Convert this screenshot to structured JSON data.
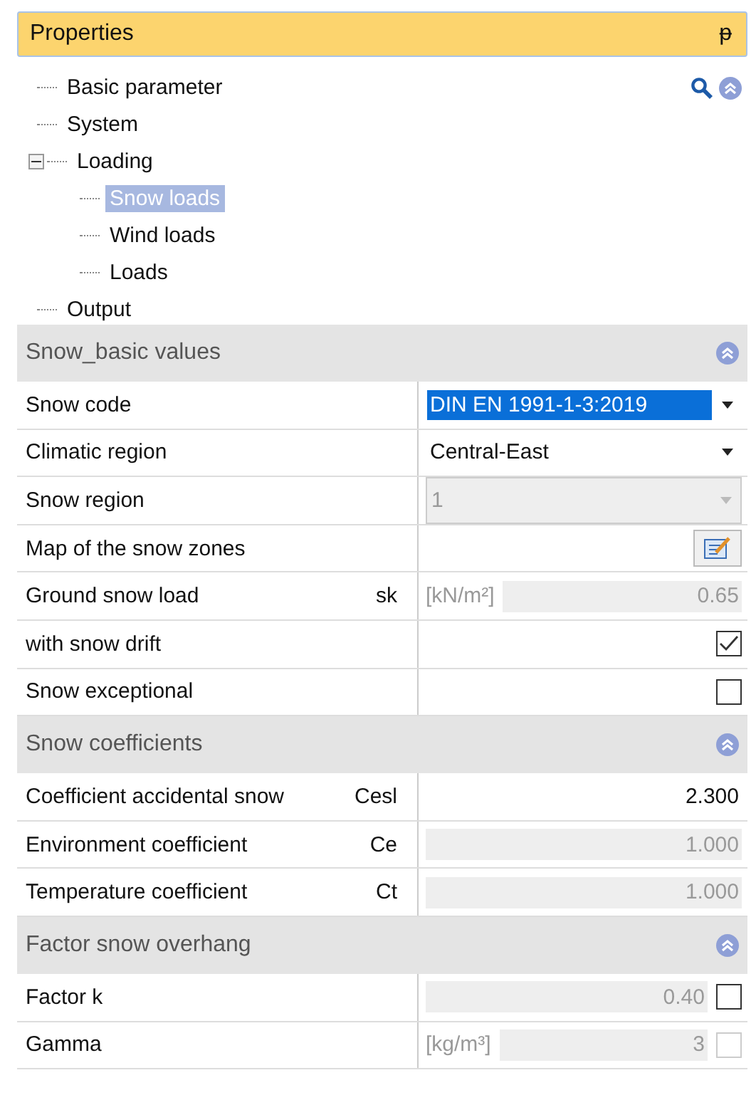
{
  "panel": {
    "title": "Properties",
    "pin": "ᵽ"
  },
  "tree": [
    {
      "label": "Basic parameter",
      "selected": false
    },
    {
      "label": "System",
      "selected": false
    },
    {
      "label": "Loading",
      "selected": false,
      "expanded": true,
      "children": [
        {
          "label": "Snow loads",
          "selected": true
        },
        {
          "label": "Wind loads",
          "selected": false
        },
        {
          "label": "Loads",
          "selected": false
        }
      ]
    },
    {
      "label": "Output",
      "selected": false
    }
  ],
  "sections": [
    {
      "title": "Snow_basic values",
      "expanded": true,
      "rows": [
        {
          "kind": "dropdown",
          "label": "Snow code",
          "value": "DIN EN 1991-1-3:2019",
          "highlighted": true,
          "disabled": false
        },
        {
          "kind": "dropdown",
          "label": "Climatic region",
          "value": "Central-East",
          "highlighted": false,
          "disabled": false
        },
        {
          "kind": "dropdown",
          "label": "Snow region",
          "value": "1",
          "highlighted": false,
          "disabled": true
        },
        {
          "kind": "button",
          "label": "Map of the snow zones"
        },
        {
          "kind": "number",
          "label": "Ground snow load",
          "symbol": "sk",
          "unit": "[kN/m²]",
          "value": "0.65",
          "disabled": true
        },
        {
          "kind": "checkbox",
          "label": "with snow drift",
          "checked": true,
          "disabled": false
        },
        {
          "kind": "checkbox",
          "label": "Snow exceptional",
          "checked": false,
          "disabled": false
        }
      ]
    },
    {
      "title": "Snow coefficients",
      "expanded": true,
      "rows": [
        {
          "kind": "number",
          "label": "Coefficient accidental snow",
          "symbol": "Cesl",
          "value": "2.300",
          "disabled": false
        },
        {
          "kind": "number",
          "label": "Environment coefficient",
          "symbol": "Ce",
          "value": "1.000",
          "disabled": true
        },
        {
          "kind": "number",
          "label": "Temperature coefficient",
          "symbol": "Ct",
          "value": "1.000",
          "disabled": true
        }
      ]
    },
    {
      "title": "Factor snow overhang",
      "expanded": true,
      "rows": [
        {
          "kind": "number_check",
          "label": "Factor k",
          "value": "0.40",
          "disabled": true,
          "checked": false,
          "check_disabled": false
        },
        {
          "kind": "number_check",
          "label": "Gamma",
          "unit": "[kg/m³]",
          "value": "3",
          "disabled": true,
          "checked": false,
          "check_disabled": true
        }
      ]
    }
  ]
}
